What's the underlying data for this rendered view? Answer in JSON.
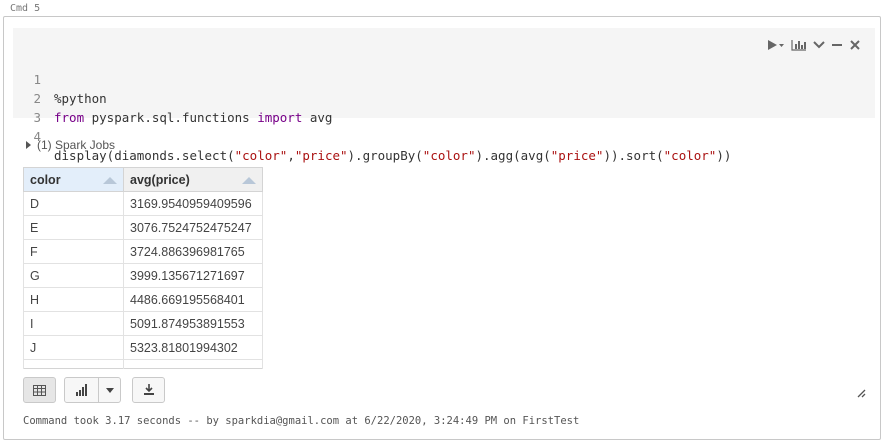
{
  "cell": {
    "label": "Cmd 5",
    "code_lines": [
      {
        "num": "1",
        "text": "%python"
      },
      {
        "num": "2",
        "kw1": "from",
        "mod": " pyspark.sql.functions ",
        "kw2": "import",
        "rest": " avg"
      },
      {
        "num": "3",
        "text": ""
      },
      {
        "num": "4",
        "pre": "display(diamonds.select(",
        "s1": "\"color\"",
        "c1": ",",
        "s2": "\"price\"",
        "mid": ").groupBy(",
        "s3": "\"color\"",
        "mid2": ").agg(avg(",
        "s4": "\"price\"",
        "mid3": ")).sort(",
        "s5": "\"color\"",
        "end": "))"
      }
    ],
    "toolbar_icons": [
      "run-icon",
      "chart-icon",
      "collapse-icon",
      "minimize-icon",
      "close-icon"
    ]
  },
  "jobs": {
    "label": "(1) Spark Jobs"
  },
  "table": {
    "headers": [
      "color",
      "avg(price)"
    ],
    "rows": [
      [
        "D",
        "3169.9540959409596"
      ],
      [
        "E",
        "3076.7524752475247"
      ],
      [
        "F",
        "3724.886396981765"
      ],
      [
        "G",
        "3999.135671271697"
      ],
      [
        "H",
        "4486.669195568401"
      ],
      [
        "I",
        "5091.874953891553"
      ],
      [
        "J",
        "5323.81801994302"
      ]
    ]
  },
  "buttons": [
    "table-view-icon",
    "bar-chart-icon",
    "download-icon"
  ],
  "status": {
    "text": "Command took 3.17 seconds -- by sparkdia@gmail.com at 6/22/2020, 3:24:49 PM on FirstTest"
  }
}
